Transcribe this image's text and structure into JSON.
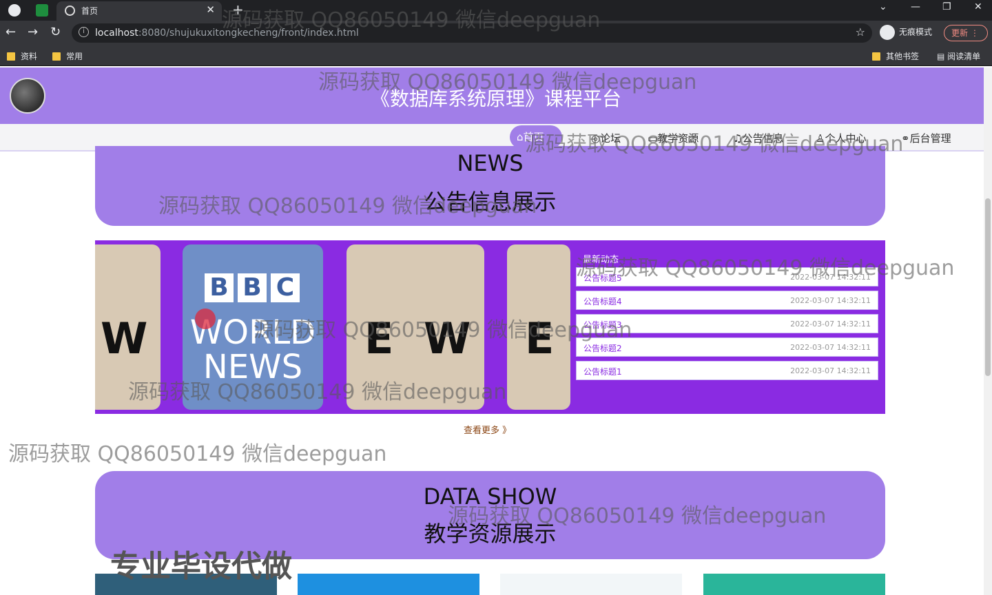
{
  "browser": {
    "tab_title": "首页",
    "tab_close": "✕",
    "new_tab": "+",
    "url_host": "localhost",
    "url_rest": ":8080/shujukuxitongkecheng/front/index.html",
    "incognito_label": "无痕模式",
    "update_label": "更新",
    "bookmarks": [
      "资料",
      "常用"
    ],
    "bookmarks_right": [
      "其他书签",
      "阅读清单"
    ]
  },
  "site": {
    "title": "《数据库系统原理》课程平台"
  },
  "nav": {
    "home": "⌂首页",
    "items": [
      "论坛",
      "教学资源",
      "公告信息",
      "个人中心",
      "后台管理"
    ]
  },
  "news_section": {
    "en": "NEWS",
    "cn": "公告信息展示",
    "latest_label": "最新动态",
    "items": [
      {
        "title": "公告标题5",
        "date": "2022-03-07 14:32:11"
      },
      {
        "title": "公告标题4",
        "date": "2022-03-07 14:32:11"
      },
      {
        "title": "公告标题3",
        "date": "2022-03-07 14:32:11"
      },
      {
        "title": "公告标题2",
        "date": "2022-03-07 14:32:11"
      },
      {
        "title": "公告标题1",
        "date": "2022-03-07 14:32:11"
      }
    ],
    "more": "查看更多 》",
    "bbc": [
      "B",
      "B",
      "C"
    ],
    "bbc_lines": [
      "WORLD",
      "NEWS"
    ],
    "card_letters": [
      "W",
      "E",
      "W",
      "E"
    ]
  },
  "data_section": {
    "en": "DATA SHOW",
    "cn": "教学资源展示"
  },
  "overlay": "专业毕设代做",
  "watermark": "源码获取 QQ86050149 微信deepguan"
}
